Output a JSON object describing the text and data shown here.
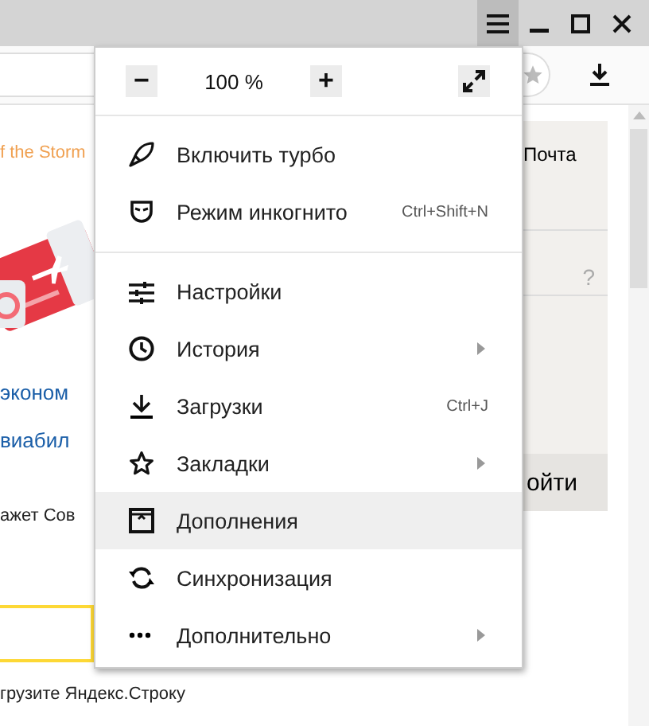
{
  "page": {
    "left": {
      "link": "f the Storm",
      "headline": [
        "эконом",
        "виабил"
      ],
      "snippet": "ажет Сов",
      "search_hint": "грузите Яндекс.Строку"
    },
    "right": {
      "mail": "Почта",
      "help": "?",
      "login": "ойти"
    }
  },
  "menu": {
    "zoom": {
      "minus": "−",
      "level": "100 %",
      "plus": "+"
    },
    "items": [
      {
        "label": "Включить турбо",
        "kind": "turbo",
        "separator_before": false,
        "submenu": false,
        "selected": false
      },
      {
        "label": "Режим инкогнито",
        "kind": "incognito",
        "shortcut": "Ctrl+Shift+N",
        "separator_before": false,
        "submenu": false,
        "selected": false
      },
      {
        "label": "Настройки",
        "kind": "settings",
        "separator_before": true,
        "submenu": false,
        "selected": false
      },
      {
        "label": "История",
        "kind": "history",
        "separator_before": false,
        "submenu": true,
        "selected": false
      },
      {
        "label": "Загрузки",
        "kind": "downloads",
        "shortcut": "Ctrl+J",
        "separator_before": false,
        "submenu": false,
        "selected": false
      },
      {
        "label": "Закладки",
        "kind": "bookmarks",
        "separator_before": false,
        "submenu": true,
        "selected": false
      },
      {
        "label": "Дополнения",
        "kind": "addons",
        "separator_before": false,
        "submenu": false,
        "selected": true
      },
      {
        "label": "Синхронизация",
        "kind": "sync",
        "separator_before": false,
        "submenu": false,
        "selected": false
      },
      {
        "label": "Дополнительно",
        "kind": "more",
        "separator_before": false,
        "submenu": true,
        "selected": false
      }
    ]
  }
}
